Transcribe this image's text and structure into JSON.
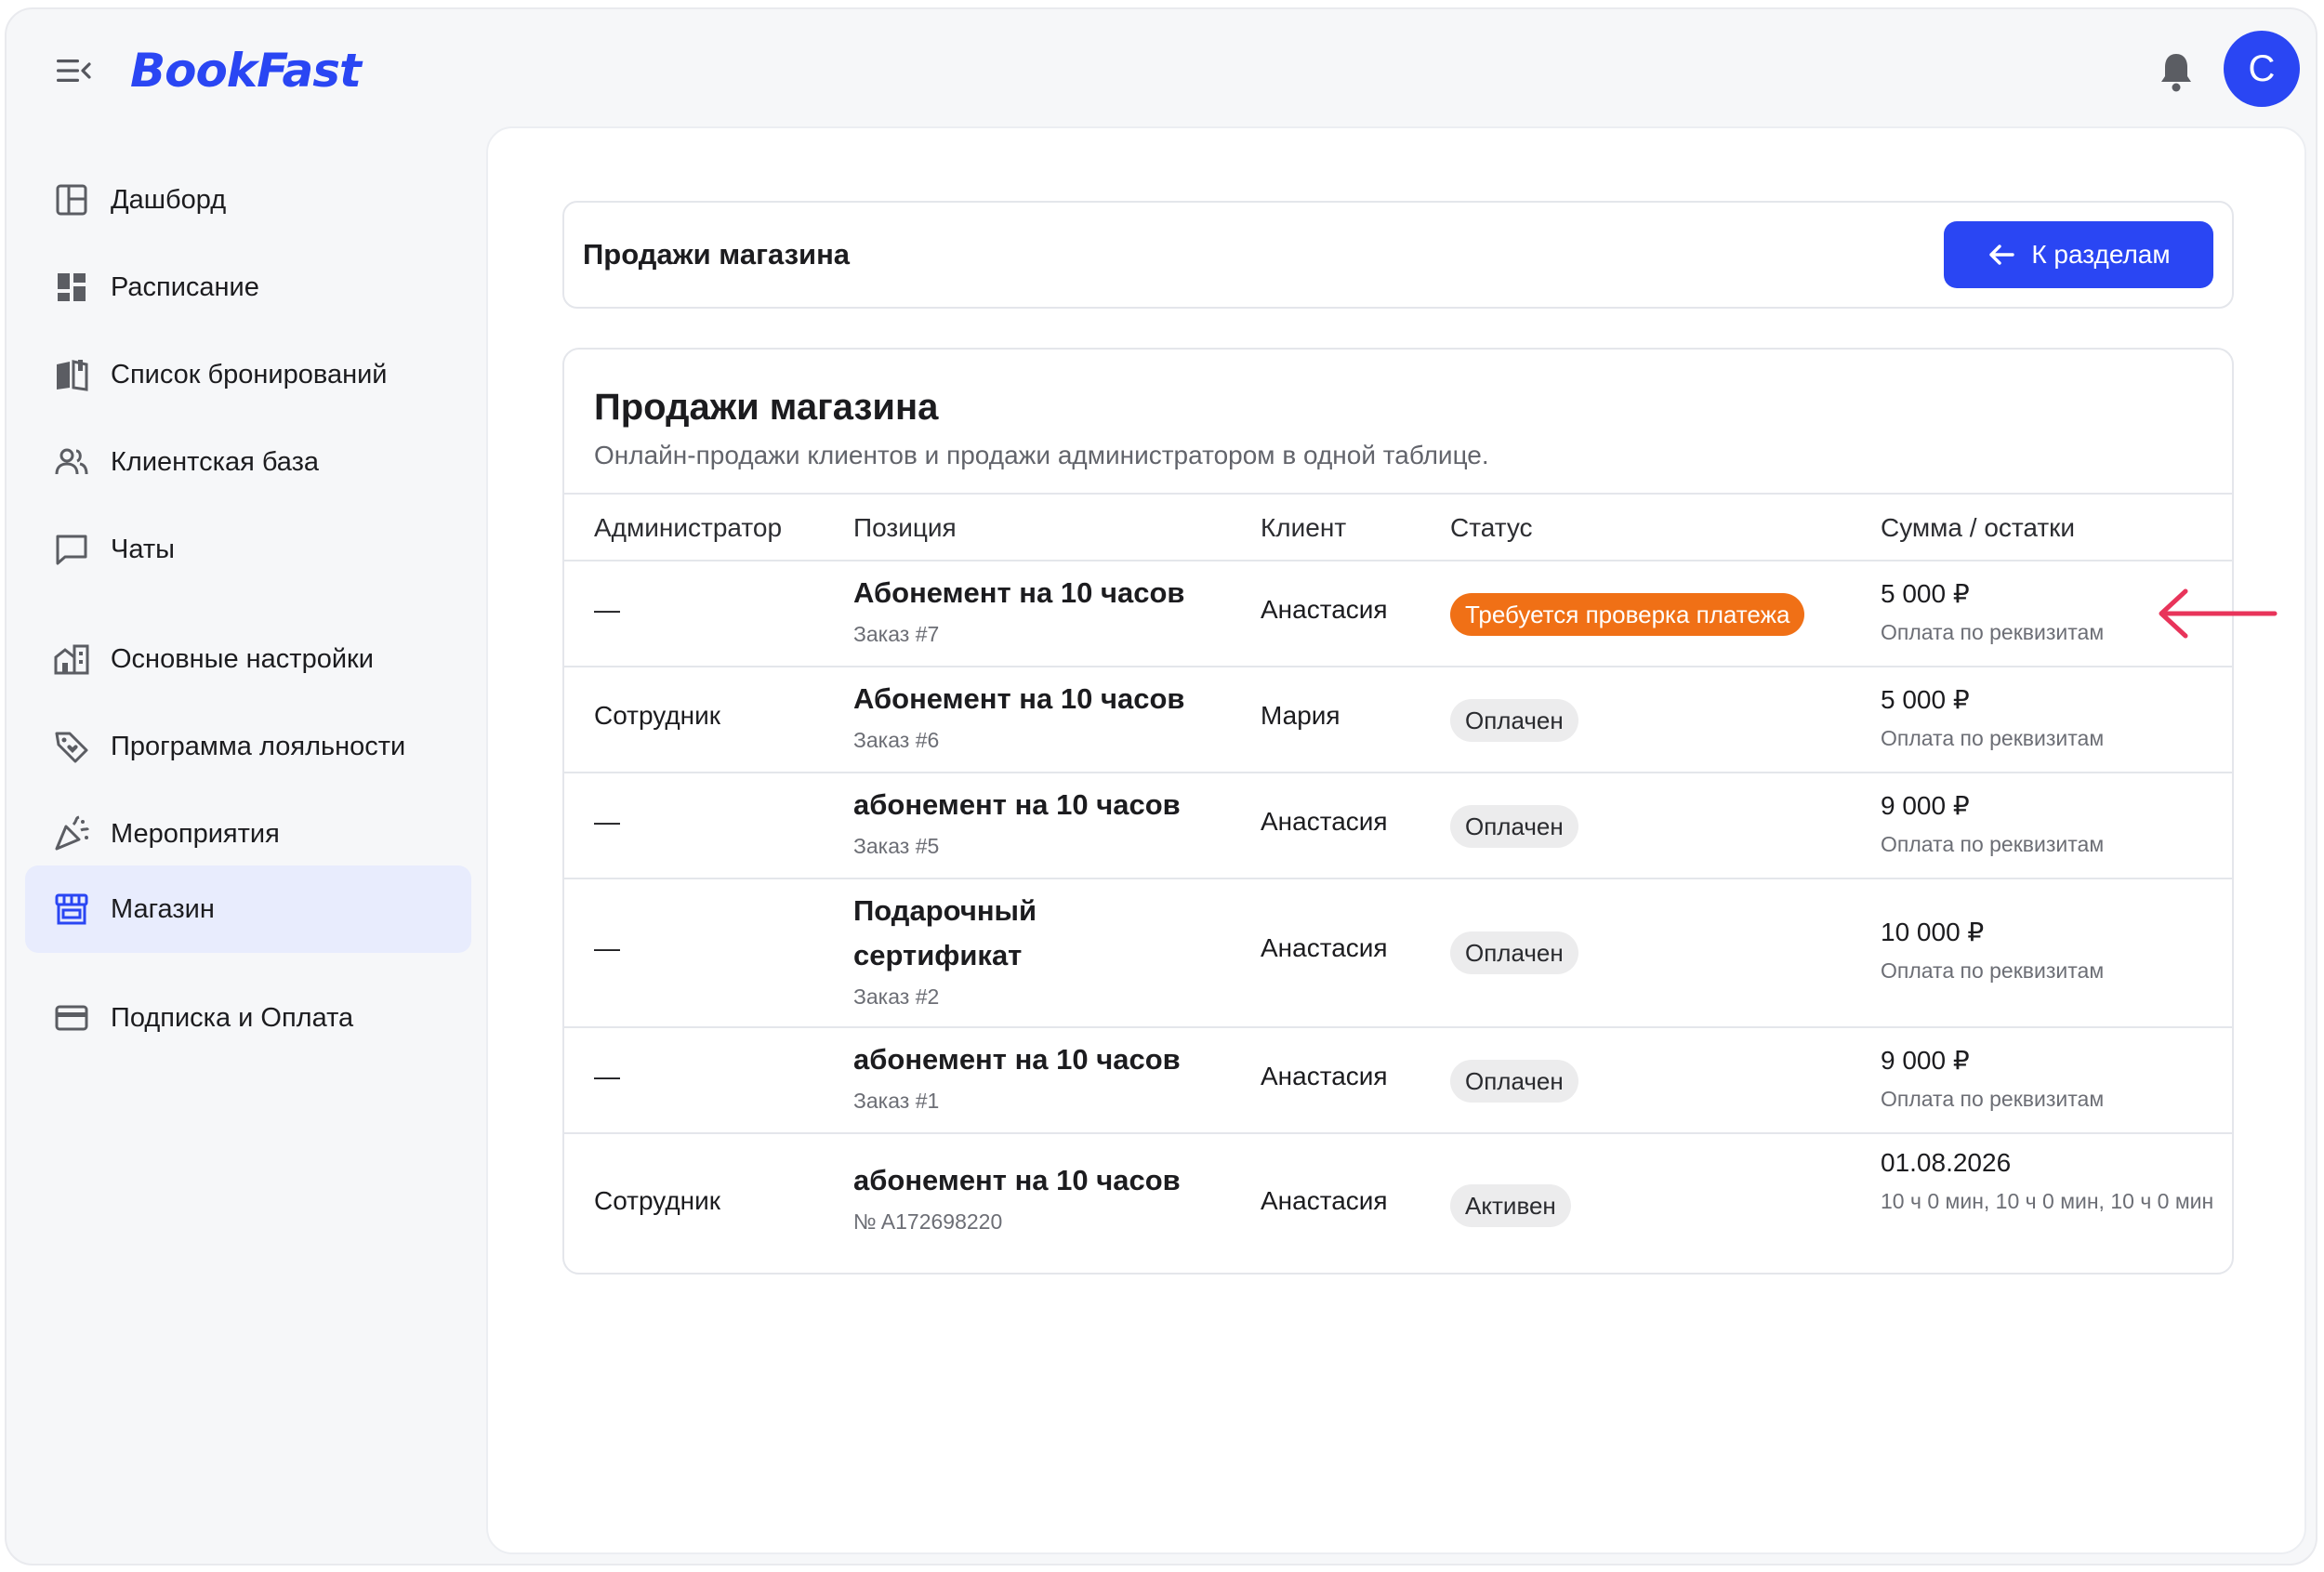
{
  "brand": {
    "logo": "BookFast",
    "avatar_letter": "C",
    "accent": "#2a46f3"
  },
  "sidebar": {
    "items": [
      {
        "label": "Дашборд",
        "icon": "layout-icon"
      },
      {
        "label": "Расписание",
        "icon": "grid-icon"
      },
      {
        "label": "Список бронирований",
        "icon": "book-icon"
      },
      {
        "label": "Клиентская база",
        "icon": "users-icon"
      },
      {
        "label": "Чаты",
        "icon": "chat-icon"
      },
      {
        "label": "Основные настройки",
        "icon": "building-icon"
      },
      {
        "label": "Программа лояльности",
        "icon": "tag-icon"
      },
      {
        "label": "Мероприятия",
        "icon": "party-icon"
      },
      {
        "label": "Магазин",
        "icon": "store-icon",
        "active": true
      },
      {
        "label": "Подписка и Оплата",
        "icon": "card-icon"
      }
    ]
  },
  "header": {
    "title": "Продажи магазина",
    "back_label": "К разделам"
  },
  "table": {
    "title": "Продажи магазина",
    "subtitle": "Онлайн-продажи клиентов и продажи администратором в одной таблице.",
    "columns": [
      "Администратор",
      "Позиция",
      "Клиент",
      "Статус",
      "Сумма / остатки"
    ],
    "rows": [
      {
        "admin": "—",
        "position": "Абонемент на 10 часов",
        "order": "Заказ #7",
        "client": "Анастасия",
        "status": "Требуется проверка платежа",
        "status_kind": "warning",
        "sum": "5 000 ₽",
        "note": "Оплата по реквизитам"
      },
      {
        "admin": "Сотрудник",
        "position": "Абонемент на 10 часов",
        "order": "Заказ #6",
        "client": "Мария",
        "status": "Оплачен",
        "status_kind": "neutral",
        "sum": "5 000 ₽",
        "note": "Оплата по реквизитам"
      },
      {
        "admin": "—",
        "position": "абонемент на 10 часов",
        "order": "Заказ #5",
        "client": "Анастасия",
        "status": "Оплачен",
        "status_kind": "neutral",
        "sum": "9 000 ₽",
        "note": "Оплата по реквизитам"
      },
      {
        "admin": "—",
        "position": "Подарочный сертификат",
        "order": "Заказ #2",
        "client": "Анастасия",
        "status": "Оплачен",
        "status_kind": "neutral",
        "sum": "10 000 ₽",
        "note": "Оплата по реквизитам"
      },
      {
        "admin": "—",
        "position": "абонемент на 10 часов",
        "order": "Заказ #1",
        "client": "Анастасия",
        "status": "Оплачен",
        "status_kind": "neutral",
        "sum": "9 000 ₽",
        "note": "Оплата по реквизитам"
      },
      {
        "admin": "Сотрудник",
        "position": "абонемент на 10 часов",
        "order": "№ A172698220",
        "client": "Анастасия",
        "status": "Активен",
        "status_kind": "neutral",
        "sum": "01.08.2026",
        "note": "10 ч 0 мин, 10 ч 0 мин, 10 ч 0 мин"
      }
    ]
  },
  "annotation": {
    "arrow_color": "#e8345a",
    "arrow_icon": "arrow-left-icon"
  }
}
